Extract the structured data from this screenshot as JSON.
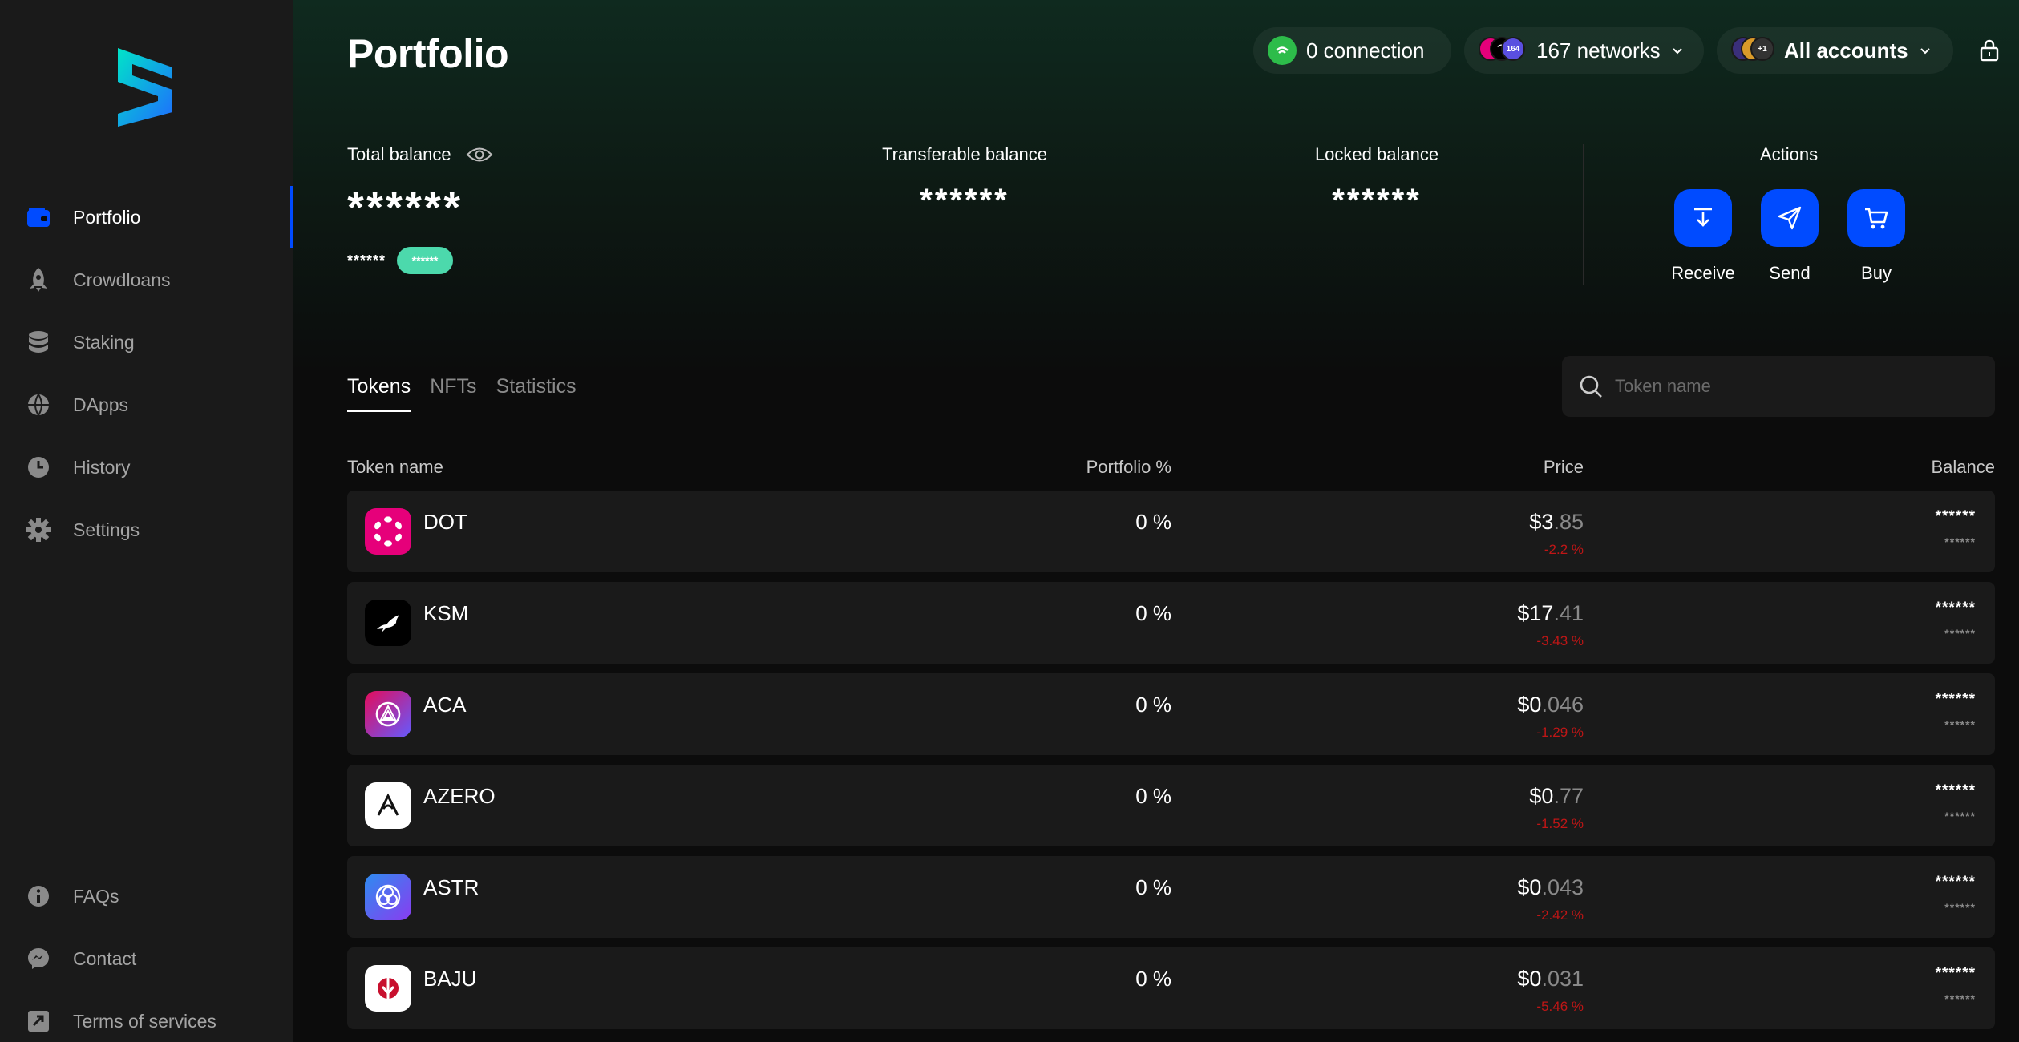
{
  "sidebar": {
    "items": [
      {
        "label": "Portfolio",
        "icon": "wallet-icon",
        "active": true
      },
      {
        "label": "Crowdloans",
        "icon": "rocket-icon"
      },
      {
        "label": "Staking",
        "icon": "database-icon"
      },
      {
        "label": "DApps",
        "icon": "globe-icon"
      },
      {
        "label": "History",
        "icon": "clock-icon"
      },
      {
        "label": "Settings",
        "icon": "gear-icon"
      }
    ],
    "bottom_items": [
      {
        "label": "FAQs",
        "icon": "info-icon"
      },
      {
        "label": "Contact",
        "icon": "messenger-icon"
      },
      {
        "label": "Terms of services",
        "icon": "document-icon"
      }
    ]
  },
  "header": {
    "title": "Portfolio",
    "connection": "0 connection",
    "networks": "167 networks",
    "networks_badge": "164",
    "accounts": "All accounts",
    "accounts_badge": "+1"
  },
  "balance": {
    "total_label": "Total balance",
    "total_value": "******",
    "total_change": "******",
    "total_change_badge": "******",
    "transferable_label": "Transferable balance",
    "transferable_value": "******",
    "locked_label": "Locked balance",
    "locked_value": "******",
    "actions_label": "Actions",
    "actions": [
      {
        "label": "Receive",
        "icon": "receive-icon"
      },
      {
        "label": "Send",
        "icon": "send-icon"
      },
      {
        "label": "Buy",
        "icon": "cart-icon"
      }
    ]
  },
  "tabs": [
    {
      "label": "Tokens",
      "active": true
    },
    {
      "label": "NFTs"
    },
    {
      "label": "Statistics"
    }
  ],
  "search": {
    "placeholder": "Token name"
  },
  "table": {
    "headers": {
      "name": "Token name",
      "portfolio": "Portfolio %",
      "price": "Price",
      "balance": "Balance"
    },
    "rows": [
      {
        "symbol": "DOT",
        "portfolio": "0 %",
        "price_main": "$3",
        "price_dec": ".85",
        "change": "-2.2 %",
        "balance": "******",
        "balance_sub": "******",
        "logo_color": "#e6007a"
      },
      {
        "symbol": "KSM",
        "portfolio": "0 %",
        "price_main": "$17",
        "price_dec": ".41",
        "change": "-3.43 %",
        "balance": "******",
        "balance_sub": "******",
        "logo_color": "#000000"
      },
      {
        "symbol": "ACA",
        "portfolio": "0 %",
        "price_main": "$0",
        "price_dec": ".046",
        "change": "-1.29 %",
        "balance": "******",
        "balance_sub": "******",
        "logo_color": "#e40c5b"
      },
      {
        "symbol": "AZERO",
        "portfolio": "0 %",
        "price_main": "$0",
        "price_dec": ".77",
        "change": "-1.52 %",
        "balance": "******",
        "balance_sub": "******",
        "logo_color": "#ffffff"
      },
      {
        "symbol": "ASTR",
        "portfolio": "0 %",
        "price_main": "$0",
        "price_dec": ".043",
        "change": "-2.42 %",
        "balance": "******",
        "balance_sub": "******",
        "logo_color": "#5a6ff0"
      },
      {
        "symbol": "BAJU",
        "portfolio": "0 %",
        "price_main": "$0",
        "price_dec": ".031",
        "change": "-5.46 %",
        "balance": "******",
        "balance_sub": "******",
        "logo_color": "#ffffff"
      }
    ]
  },
  "colors": {
    "accent": "#004bff",
    "negative": "#bf1616",
    "positive_badge": "#4cd9ac"
  }
}
